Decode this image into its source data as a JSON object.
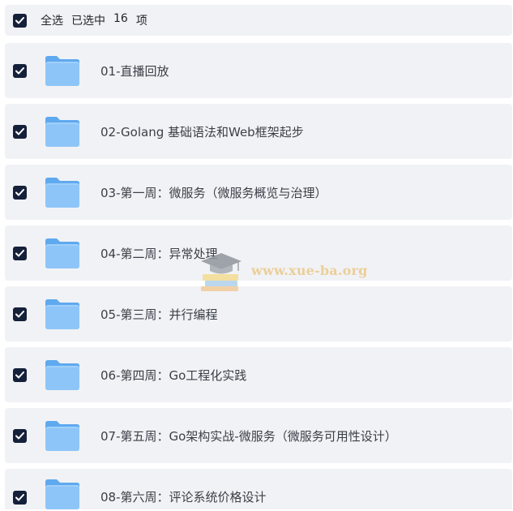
{
  "header": {
    "select_all": "全选",
    "selected_prefix": "已选中",
    "selected_count": "16",
    "selected_suffix": "项"
  },
  "icons": {
    "checkbox": "check-icon",
    "folder": "folder-icon"
  },
  "colors": {
    "checkbox_bg": "#15203a",
    "folder_primary": "#7bbcf7",
    "row_bg": "#f1f2f5"
  },
  "folders": [
    {
      "name": "01-直播回放"
    },
    {
      "name": "02-Golang 基础语法和Web框架起步"
    },
    {
      "name": "03-第一周：微服务（微服务概览与治理）"
    },
    {
      "name": "04-第二周：异常处理"
    },
    {
      "name": "05-第三周：并行编程"
    },
    {
      "name": "06-第四周：Go工程化实践"
    },
    {
      "name": "07-第五周：Go架构实战-微服务（微服务可用性设计）"
    },
    {
      "name": "08-第六周：评论系统价格设计"
    }
  ],
  "watermark": {
    "text": "www.xue-ba.org"
  }
}
